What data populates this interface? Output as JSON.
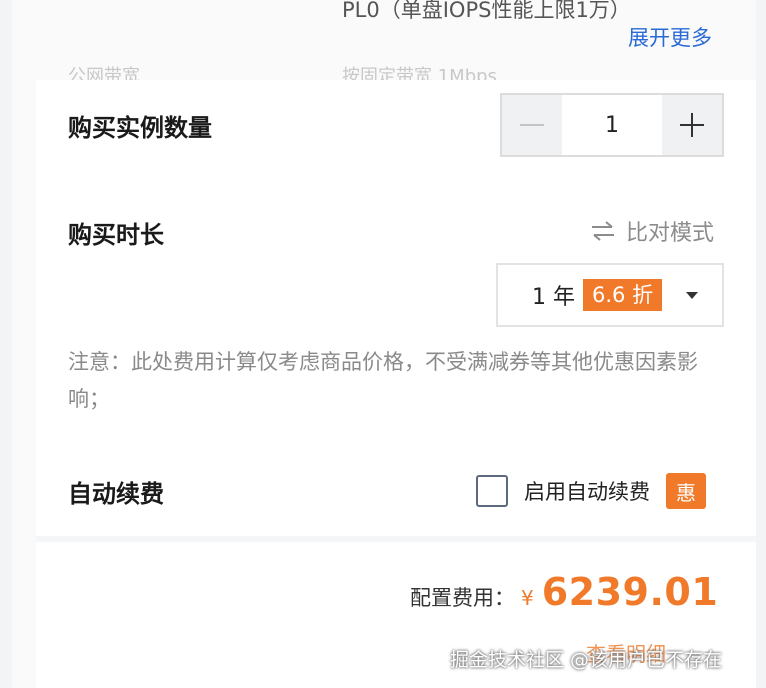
{
  "disk": {
    "type_text": "PL0（单盘IOPS性能上限1万）",
    "expand_label": "展开更多",
    "ghost_left": "公网带宽",
    "ghost_right": "按固定带宽 1Mbps"
  },
  "quantity": {
    "title": "购买实例数量",
    "value": "1",
    "minus": "−",
    "plus": "+"
  },
  "duration": {
    "title": "购买时长",
    "compare_label": "比对模式",
    "selected": "1 年",
    "discount": "6.6 折"
  },
  "note": {
    "text": "注意：此处费用计算仅考虑商品价格，不受满减券等其他优惠因素影响；"
  },
  "renew": {
    "title": "自动续费",
    "checkbox_label": "启用自动续费",
    "badge": "惠",
    "checked": false
  },
  "price": {
    "label": "配置费用：",
    "currency": "¥",
    "amount": "6239.01",
    "detail_link": "查看明细"
  },
  "watermark": "掘金技术社区 @该用户已不存在",
  "colors": {
    "accent": "#f07a2a",
    "link": "#2a6ad6"
  }
}
